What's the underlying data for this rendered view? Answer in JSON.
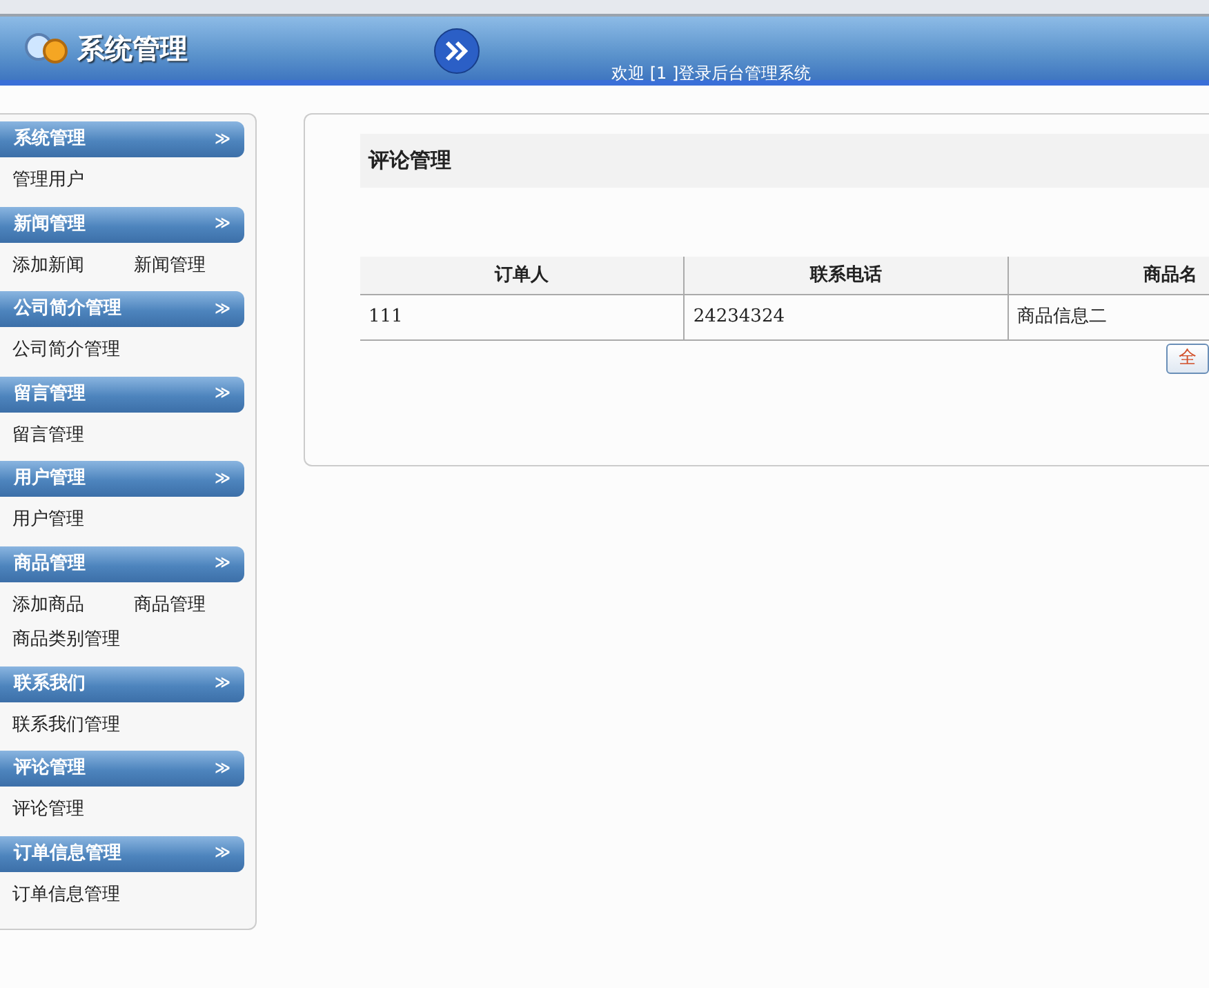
{
  "header": {
    "title": "系统管理",
    "welcome": "欢迎 [1 ]登录后台管理系统"
  },
  "sidebar": {
    "sections": [
      {
        "title": "系统管理",
        "toggle": "≫",
        "items": [
          "管理用户"
        ]
      },
      {
        "title": "新闻管理",
        "toggle": "≫",
        "items": [
          "添加新闻",
          "新闻管理"
        ]
      },
      {
        "title": "公司简介管理",
        "toggle": "≫",
        "items": [
          "公司简介管理"
        ]
      },
      {
        "title": "留言管理",
        "toggle": "≫",
        "items": [
          "留言管理"
        ]
      },
      {
        "title": "用户管理",
        "toggle": "≫",
        "items": [
          "用户管理"
        ]
      },
      {
        "title": "商品管理",
        "toggle": "≫",
        "items": [
          "添加商品",
          "商品管理",
          "商品类别管理"
        ]
      },
      {
        "title": "联系我们",
        "toggle": "≫",
        "items": [
          "联系我们管理"
        ]
      },
      {
        "title": "评论管理",
        "toggle": "≫",
        "items": [
          "评论管理"
        ]
      },
      {
        "title": "订单信息管理",
        "toggle": "≫",
        "items": [
          "订单信息管理"
        ]
      }
    ]
  },
  "panel": {
    "title": "评论管理",
    "table": {
      "columns": [
        "订单人",
        "联系电话",
        "商品名"
      ],
      "rows": [
        [
          "111",
          "24234324",
          "商品信息二"
        ]
      ]
    },
    "button": "全"
  }
}
